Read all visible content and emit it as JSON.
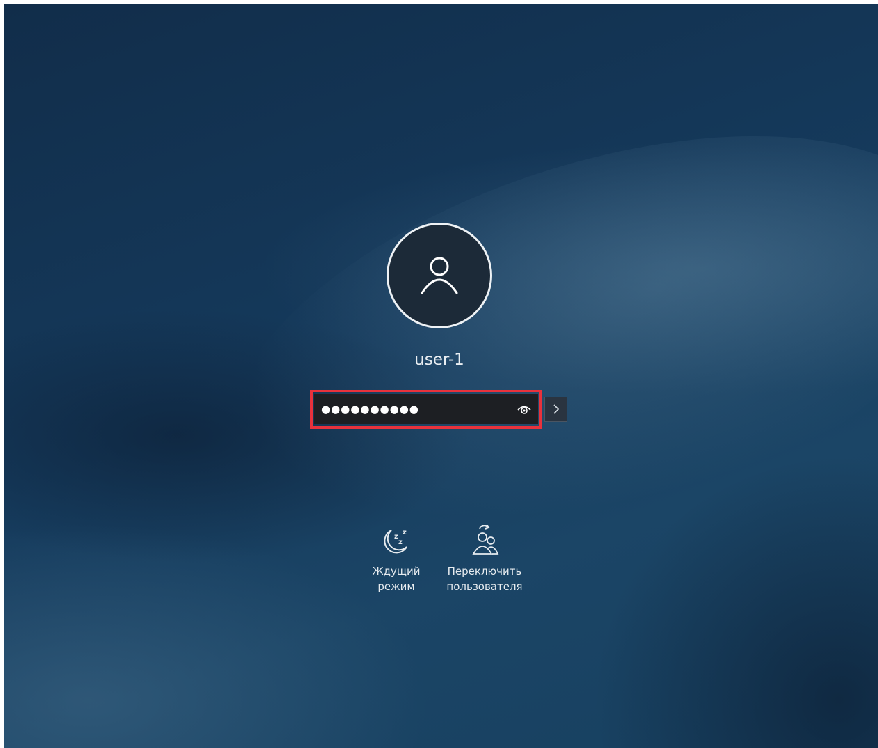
{
  "user": {
    "name": "user-1"
  },
  "password": {
    "masked_value": "●●●●●●●●●●",
    "show_icon": "eye-icon",
    "submit_icon": "chevron-right-icon",
    "highlight_color": "#e8323c"
  },
  "actions": [
    {
      "label_line1": "Ждущий",
      "label_line2": "режим",
      "icon": "sleep-moon-icon"
    },
    {
      "label_line1": "Переключить",
      "label_line2": "пользователя",
      "icon": "switch-user-icon"
    }
  ],
  "colors": {
    "field_background": "#1d1f23",
    "avatar_ring": "#eef2f5",
    "text": "#e9eef2"
  }
}
